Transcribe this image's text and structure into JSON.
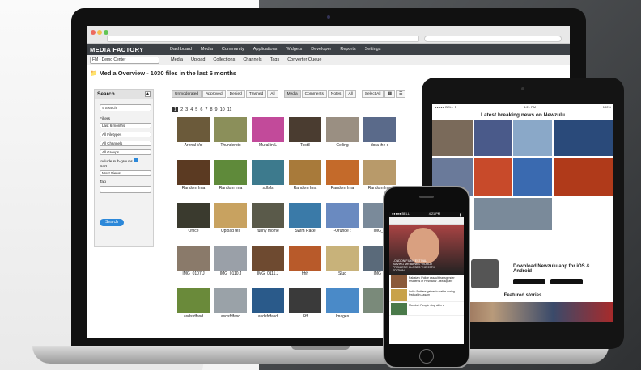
{
  "app": {
    "logo": "MEDIA FACTORY",
    "nav": [
      "Dashboard",
      "Media",
      "Community",
      "Applications",
      "Widgets",
      "Developer",
      "Reports",
      "Settings"
    ],
    "site_selector": "FM - Demo Center",
    "subnav": [
      "Media",
      "Upload",
      "Collections",
      "Channels",
      "Tags",
      "Converter Queue"
    ],
    "page_title_prefix": "Media Overview",
    "page_title_suffix": " - 1030 files in the last 6 months"
  },
  "search_panel": {
    "title": "Search",
    "collapse_glyph": "▲",
    "search_placeholder": "Search",
    "filters_label": "Filters",
    "filters": [
      "Last 6 months",
      "All Filetypes",
      "All Channels",
      "All Groups"
    ],
    "include_subgroups": "Include sub-groups",
    "sort_label": "Sort",
    "sort_value": "Most Views",
    "tag_label": "Tag",
    "search_button": "Search"
  },
  "status_tabs": [
    "Unmoderated",
    "Approved",
    "Denied",
    "Trashed",
    "All"
  ],
  "type_tabs": [
    "Media",
    "Comments",
    "Notes",
    "All"
  ],
  "select_all": "Select All",
  "pages": [
    "1",
    "2",
    "3",
    "4",
    "5",
    "6",
    "7",
    "8",
    "9",
    "10",
    "11"
  ],
  "media_grid": [
    {
      "caption": "Arenal Vol",
      "color": "#6b5a3a"
    },
    {
      "caption": "Thundersto",
      "color": "#8b8f5a"
    },
    {
      "caption": "Mural in L",
      "color": "#c24a9a"
    },
    {
      "caption": "Test3",
      "color": "#4a3c30"
    },
    {
      "caption": "Ceiling",
      "color": "#9a8f82"
    },
    {
      "caption": "dora the c",
      "color": "#5a6a8a"
    },
    {
      "caption": "Random Ima",
      "color": "#5b3a22"
    },
    {
      "caption": "Random Ima",
      "color": "#5f8a3a"
    },
    {
      "caption": "sdfsfs",
      "color": "#3d7a8d"
    },
    {
      "caption": "Random Ima",
      "color": "#a87a3a"
    },
    {
      "caption": "Random Ima",
      "color": "#c46a2a"
    },
    {
      "caption": "Random Ima",
      "color": "#b89a6a"
    },
    {
      "caption": "Office",
      "color": "#3a3a2e"
    },
    {
      "caption": "Upload tes",
      "color": "#c8a260"
    },
    {
      "caption": "funny mome",
      "color": "#5a5a4a"
    },
    {
      "caption": "Swim Race",
      "color": "#3a7aa8"
    },
    {
      "caption": "-Orunde t",
      "color": "#6a8ac0"
    },
    {
      "caption": "IMG_0",
      "color": "#7a8a9a"
    },
    {
      "caption": "IMG_0107.J",
      "color": "#8a7a6a"
    },
    {
      "caption": "IMG_0110.J",
      "color": "#9aa0a8"
    },
    {
      "caption": "IMG_0111.J",
      "color": "#6e4a30"
    },
    {
      "caption": "hhh",
      "color": "#b85a2a"
    },
    {
      "caption": "Slug",
      "color": "#c8b27a"
    },
    {
      "caption": "IMG_0",
      "color": "#5a6a7a"
    },
    {
      "caption": "asdsfdfasd",
      "color": "#6a8a3a"
    },
    {
      "caption": "asdsfdfasd",
      "color": "#9aa2a8"
    },
    {
      "caption": "asdsfdfasd",
      "color": "#2a5a8a"
    },
    {
      "caption": "Fff",
      "color": "#3a3a3a"
    },
    {
      "caption": "Images",
      "color": "#4a8ac8"
    },
    {
      "caption": "",
      "color": "#7a8a7a"
    }
  ],
  "tablet": {
    "status_left": "●●●●● BELL ✈",
    "status_time": "4:21 PM",
    "status_right": "100%",
    "headline": "Latest breaking news on Newzulu",
    "tiles": [
      {
        "color": "#7a6a5a",
        "text": ""
      },
      {
        "color": "#4a5a8a",
        "text": ""
      },
      {
        "color": "#8aa8c8",
        "text": ""
      },
      {
        "color": "#2a4a7a",
        "text": ""
      },
      {
        "color": "#6a7a9a",
        "text": ""
      },
      {
        "color": "#c84a2a",
        "text": ""
      },
      {
        "color": "#3a6ab0",
        "text": ""
      },
      {
        "color": "#b03a1a",
        "text": ""
      },
      {
        "color": "#7a8a9a",
        "text": ""
      }
    ],
    "promo_title": "Download Newzulu app for iOS & Android",
    "featured_title": "Featured stories"
  },
  "phone": {
    "status_left": "●●●●● BELL",
    "status_time": "4:21 PM",
    "hero_text": "LONDON FILM FESTIVAL: 'SAVING MR BANKS' WORLD PREMIERE CLOSES THE 57TH EDITION",
    "headlines": [
      "Pakistan: Police assault transgender residents of Peshawar - tea square",
      "India: Bathers gather to bathe during festival in Assam",
      "Mumbai: People stop sit in a"
    ]
  }
}
